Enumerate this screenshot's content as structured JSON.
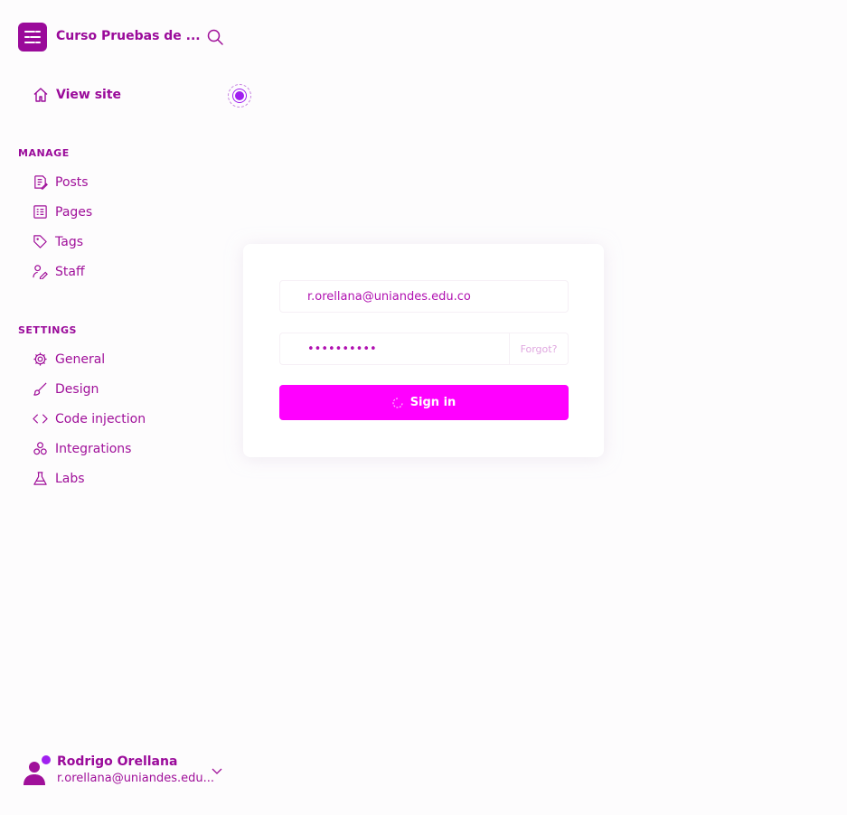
{
  "brand": {
    "title": "Curso Pruebas de ...",
    "logo_icon": "menu-lines-icon"
  },
  "sidebar": {
    "view_site_label": "View site",
    "manage_label": "MANAGE",
    "manage_items": [
      {
        "label": "Posts",
        "icon": "posts-icon"
      },
      {
        "label": "Pages",
        "icon": "pages-icon"
      },
      {
        "label": "Tags",
        "icon": "tag-icon"
      },
      {
        "label": "Staff",
        "icon": "staff-icon"
      }
    ],
    "settings_label": "SETTINGS",
    "settings_items": [
      {
        "label": "General",
        "icon": "gear-icon"
      },
      {
        "label": "Design",
        "icon": "brush-icon"
      },
      {
        "label": "Code injection",
        "icon": "code-icon"
      },
      {
        "label": "Integrations",
        "icon": "integrations-icon"
      },
      {
        "label": "Labs",
        "icon": "flask-icon"
      }
    ]
  },
  "login": {
    "email_value": "r.orellana@uniandes.edu.co",
    "password_value": "••••••••••",
    "forgot_label": "Forgot?",
    "signin_label": "Sign in"
  },
  "user": {
    "name": "Rodrigo Orellana",
    "email": "r.orellana@uniandes.edu..."
  },
  "colors": {
    "accent": "#9a0a9a",
    "button": "#ff00ff",
    "background": "#fdfcfd"
  }
}
